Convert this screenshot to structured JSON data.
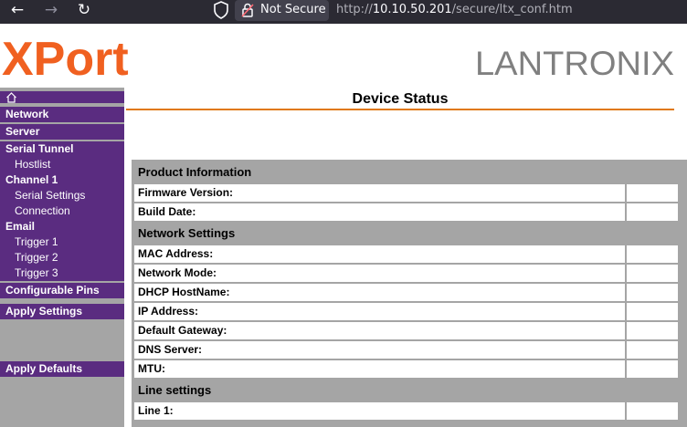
{
  "browser": {
    "security_label": "Not Secure",
    "url_prefix": "http://",
    "url_host": "10.10.50.201",
    "url_path": "/secure/ltx_conf.htm"
  },
  "header": {
    "product_logo_text": "XPort",
    "brand_logo_text": "LANTRONIX",
    "product_color": "#f06020",
    "brand_color": "#808080"
  },
  "sidebar": {
    "items": [
      {
        "label": "Network"
      },
      {
        "label": "Server"
      },
      {
        "label": "Serial Tunnel"
      },
      {
        "label": "Hostlist"
      },
      {
        "label": "Channel 1"
      },
      {
        "label": "Serial Settings"
      },
      {
        "label": "Connection"
      },
      {
        "label": "Email"
      },
      {
        "label": "Trigger 1"
      },
      {
        "label": "Trigger 2"
      },
      {
        "label": "Trigger 3"
      },
      {
        "label": "Configurable Pins"
      },
      {
        "label": "Apply Settings"
      },
      {
        "label": "Apply Defaults"
      }
    ]
  },
  "main": {
    "title": "Device Status",
    "sections": [
      {
        "title": "Product Information",
        "rows": [
          {
            "label": "Firmware Version:",
            "value": ""
          },
          {
            "label": "Build Date:",
            "value": ""
          }
        ]
      },
      {
        "title": "Network Settings",
        "rows": [
          {
            "label": "MAC Address:",
            "value": ""
          },
          {
            "label": "Network Mode:",
            "value": ""
          },
          {
            "label": "DHCP HostName:",
            "value": ""
          },
          {
            "label": "IP Address:",
            "value": ""
          },
          {
            "label": "Default Gateway:",
            "value": ""
          },
          {
            "label": "DNS Server:",
            "value": ""
          },
          {
            "label": "MTU:",
            "value": ""
          }
        ]
      },
      {
        "title": "Line settings",
        "rows": [
          {
            "label": "Line 1:",
            "value": ""
          }
        ]
      }
    ]
  },
  "colors": {
    "sidebar_bg": "#a5a5a5",
    "menu_purple": "#5a2c80",
    "title_rule": "#e07810"
  }
}
